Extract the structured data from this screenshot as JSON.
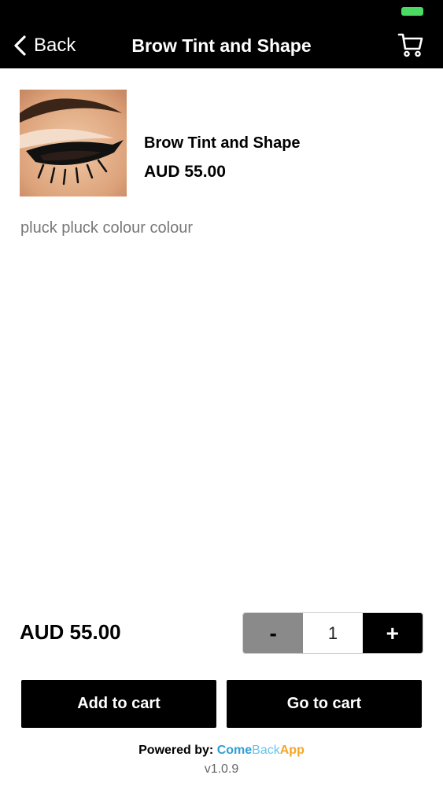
{
  "nav": {
    "back_label": "Back",
    "title": "Brow Tint and Shape",
    "cart_icon": "cart-icon"
  },
  "product": {
    "image_icon": "eye-makeup-image",
    "name": "Brow Tint and Shape",
    "price": "AUD 55.00",
    "description": "pluck pluck colour colour"
  },
  "purchase": {
    "total_price": "AUD 55.00",
    "minus_label": "-",
    "quantity": "1",
    "plus_label": "+",
    "add_to_cart_label": "Add to cart",
    "go_to_cart_label": "Go to cart"
  },
  "footer": {
    "powered_by_label": "Powered by:",
    "brand_part1": "Come",
    "brand_part2": "Back",
    "brand_part3": "App",
    "version": "v1.0.9"
  },
  "colors": {
    "header_bg": "#000000",
    "battery": "#4cd964",
    "brand_blue": "#2f9fd6",
    "brand_orange": "#f5a623",
    "minus_bg": "#8a8a8a"
  }
}
